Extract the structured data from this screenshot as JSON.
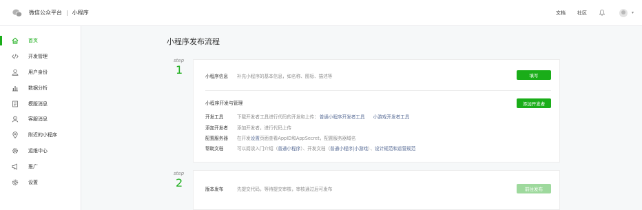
{
  "header": {
    "app_name": "微信公众平台",
    "separator": "|",
    "product": "小程序",
    "links": [
      "文档",
      "社区"
    ]
  },
  "sidebar": {
    "items": [
      {
        "label": "首页",
        "icon": "home-icon",
        "active": true
      },
      {
        "label": "开发管理",
        "icon": "code-icon"
      },
      {
        "label": "用户身份",
        "icon": "user-icon"
      },
      {
        "label": "数据分析",
        "icon": "bar-chart-icon"
      },
      {
        "label": "模版消息",
        "icon": "document-icon"
      },
      {
        "label": "客服消息",
        "icon": "customer-service-icon"
      },
      {
        "label": "附近的小程序",
        "icon": "location-icon"
      },
      {
        "label": "运维中心",
        "icon": "gear-icon"
      },
      {
        "label": "推广",
        "icon": "megaphone-icon"
      },
      {
        "label": "设置",
        "icon": "settings-icon"
      }
    ]
  },
  "main": {
    "title": "小程序发布流程",
    "steps": [
      {
        "label": "step",
        "num": "1"
      },
      {
        "label": "step",
        "num": "2"
      }
    ],
    "card1": {
      "info_label": "小程序信息",
      "info_desc": "补充小程序的基本信息，如名称、图标、描述等",
      "info_button": "填写",
      "dev_title": "小程序开发与管理",
      "dev_button": "添加开发者",
      "rows": [
        {
          "label": "开发工具",
          "text": "下载开发者工具进行代码的开发和上传：",
          "link1": "普通小程序开发者工具",
          "link2": "小游戏开发者工具"
        },
        {
          "label": "添加开发者",
          "text": "添加开发者，进行代码上传"
        },
        {
          "label": "配置服务器",
          "text_pre": "在开发",
          "link": "设置",
          "text_post": "页面查看AppID和AppSecret，配置服务器域名"
        },
        {
          "label": "帮助文档",
          "text": "可以阅读入门介绍（",
          "link1": "普通小程序",
          "mid": "）、开发文档（",
          "link2": "普通小程序|小游戏",
          "end": "）、",
          "link3": "设计规范和运营规范"
        }
      ]
    },
    "card2": {
      "label": "版本发布",
      "desc": "先提交代码，等待提交审核，审核通过后可发布",
      "button": "前往发布"
    }
  },
  "colors": {
    "accent": "#1aad19",
    "link": "#576b95",
    "button_disabled": "#9ed99d"
  }
}
